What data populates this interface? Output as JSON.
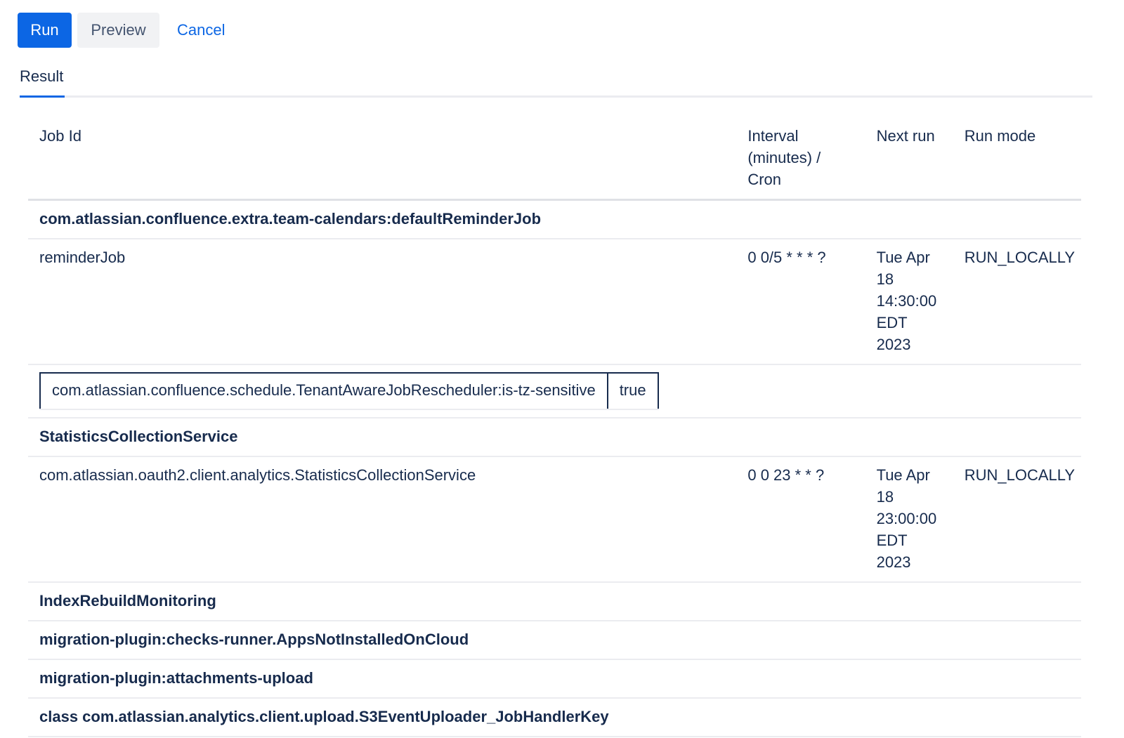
{
  "toolbar": {
    "run_label": "Run",
    "preview_label": "Preview",
    "cancel_label": "Cancel"
  },
  "tabs": [
    {
      "label": "Result",
      "active": true
    }
  ],
  "table": {
    "headers": {
      "job_id": "Job Id",
      "interval_line1": "Interval",
      "interval_line2": "(minutes) /",
      "interval_line3": "Cron",
      "next_run": "Next run",
      "run_mode": "Run mode"
    },
    "groups": [
      {
        "title": "com.atlassian.confluence.extra.team-calendars:defaultReminderJob",
        "job": {
          "id": "reminderJob",
          "interval": "0 0/5 * * * ?",
          "next_run": [
            "Tue Apr",
            "18",
            "14:30:00",
            "EDT",
            "2023"
          ],
          "run_mode": "RUN_LOCALLY"
        },
        "params": {
          "key": "com.atlassian.confluence.schedule.TenantAwareJobRescheduler:is-tz-sensitive",
          "value": "true"
        }
      },
      {
        "title": "StatisticsCollectionService",
        "job": {
          "id": "com.atlassian.oauth2.client.analytics.StatisticsCollectionService",
          "interval": "0 0 23 * * ?",
          "next_run": [
            "Tue Apr",
            "18",
            "23:00:00",
            "EDT",
            "2023"
          ],
          "run_mode": "RUN_LOCALLY"
        }
      },
      {
        "title": "IndexRebuildMonitoring"
      },
      {
        "title": "migration-plugin:checks-runner.AppsNotInstalledOnCloud"
      },
      {
        "title": "migration-plugin:attachments-upload"
      },
      {
        "title": "class com.atlassian.analytics.client.upload.S3EventUploader_JobHandlerKey"
      }
    ]
  },
  "colors": {
    "primary": "#0c66e4",
    "text": "#172b4d",
    "subtle_bg": "#f1f2f4",
    "border": "#dfe1e6"
  }
}
